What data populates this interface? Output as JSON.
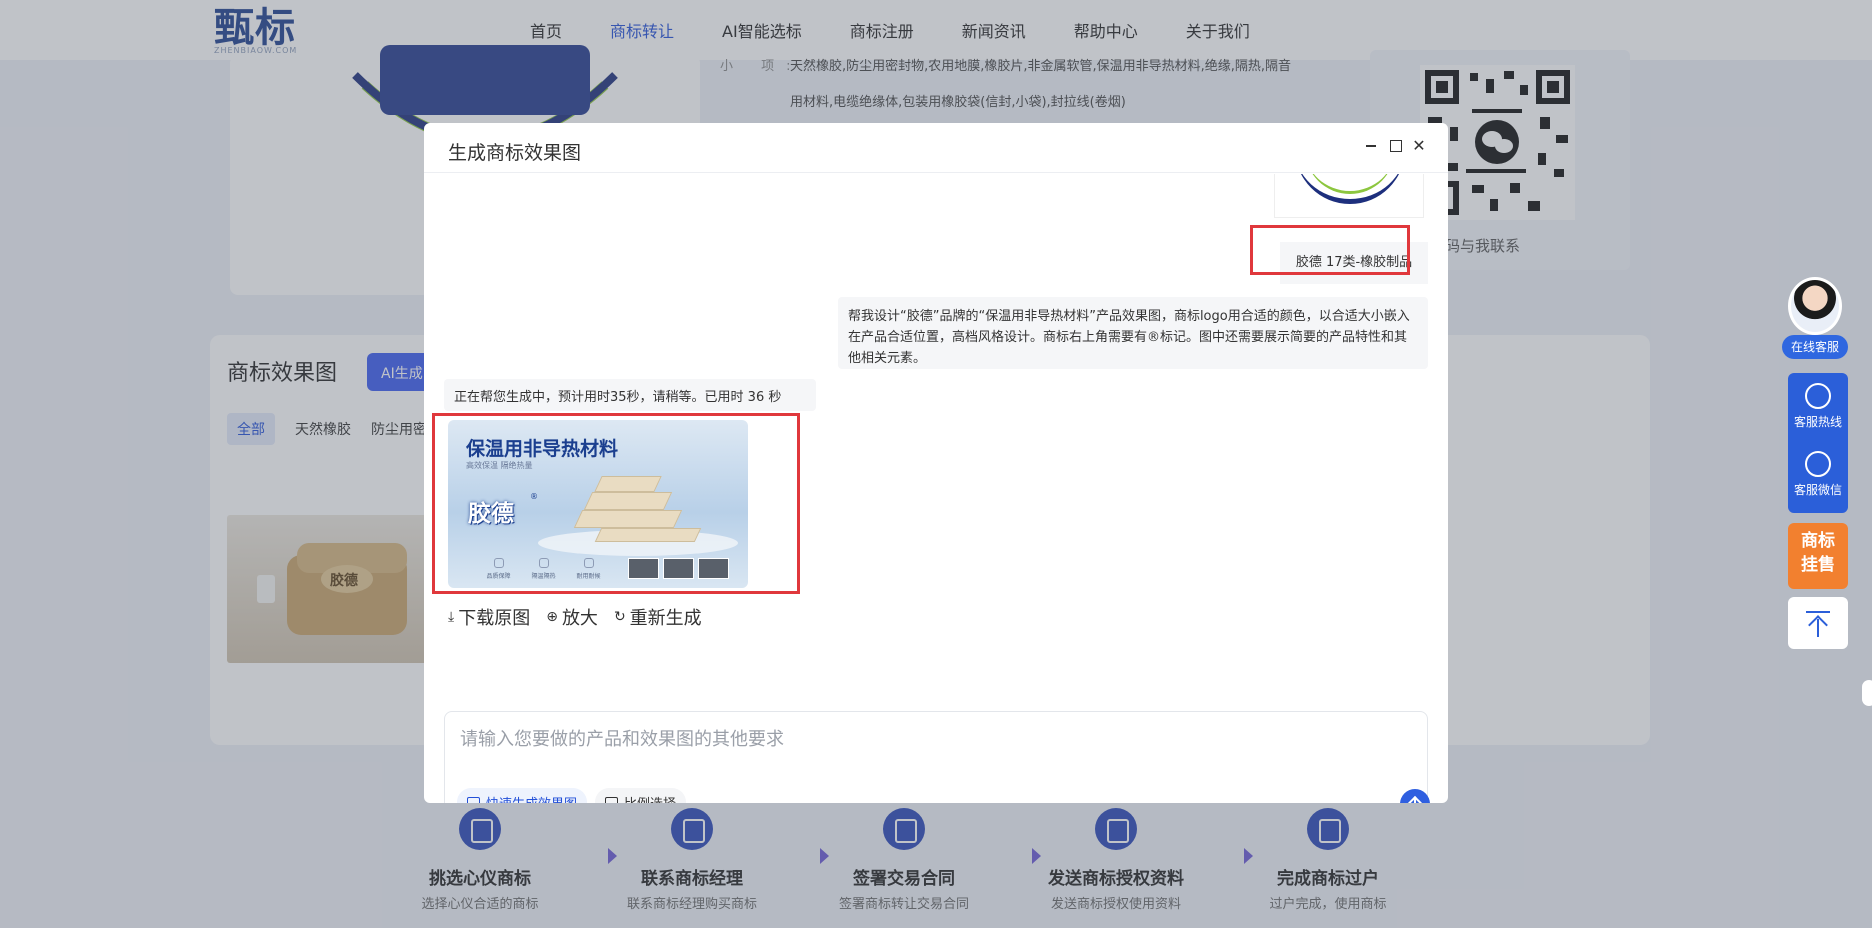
{
  "site": {
    "logo_text": "甄标",
    "logo_sub": "ZHENBIAOW.COM",
    "nav": [
      {
        "label": "首页"
      },
      {
        "label": "商标转让"
      },
      {
        "label": "AI智能选标"
      },
      {
        "label": "商标注册"
      },
      {
        "label": "新闻资讯"
      },
      {
        "label": "帮助中心"
      },
      {
        "label": "关于我们"
      }
    ],
    "active_nav": "商标转让",
    "goods_label": "小 项:",
    "goods_line1": "天然橡胶,防尘用密封物,农用地膜,橡胶片,非金属软管,保温用非导热材料,绝缘,隔热,隔音",
    "goods_line2": "用材料,电缆绝缘体,包装用橡胶袋(信封,小袋),封拉线(卷烟)",
    "qr_caption": "微信扫码与我联系",
    "effects_title": "商标效果图",
    "ai_button": "AI生成",
    "filters": [
      "全部",
      "天然橡胶",
      "防尘用密"
    ],
    "thumb_brand": "胶德"
  },
  "steps": [
    {
      "title": "挑选心仪商标",
      "sub": "选择心仪合适的商标"
    },
    {
      "title": "联系商标经理",
      "sub": "联系商标经理购买商标"
    },
    {
      "title": "签署交易合同",
      "sub": "签署商标转让交易合同"
    },
    {
      "title": "发送商标授权资料",
      "sub": "发送商标授权使用资料"
    },
    {
      "title": "完成商标过户",
      "sub": "过户完成，使用商标"
    }
  ],
  "float_bar": {
    "online": "在线客服",
    "hotline": "客服热线",
    "wechat": "客服微信",
    "sale_line1": "商标",
    "sale_line2": "挂售"
  },
  "modal": {
    "title": "生成商标效果图",
    "user_tag": "胶德 17类-橡胶制品",
    "user_prompt": "帮我设计“胶德”品牌的“保温用非导热材料”产品效果图，商标logo用合适的颜色，以合适大小嵌入在产品合适位置，高档风格设计。商标右上角需要有®标记。图中还需要展示简要的产品特性和其他相关元素。",
    "bot_status": "正在帮您生成中，预计用时35秒，请稍等。已用时 36 秒",
    "image": {
      "title": "保温用非导热材料",
      "subtitle": "高效保温 隔绝热量",
      "brand": "胶德",
      "features": [
        "品质保障",
        "隔温隔热",
        "耐用耐候"
      ]
    },
    "actions": [
      {
        "icon": "download-icon",
        "label": "下载原图"
      },
      {
        "icon": "zoom-in-icon",
        "label": "放大"
      },
      {
        "icon": "refresh-icon",
        "label": "重新生成"
      }
    ],
    "input_placeholder": "请输入您要做的产品和效果图的其他要求",
    "chip_fast": "快速生成效果图",
    "chip_ratio": "比例选择"
  },
  "colors": {
    "accent": "#2f5fe0",
    "highlight_red": "#e0383c",
    "orange": "#f2802f"
  }
}
